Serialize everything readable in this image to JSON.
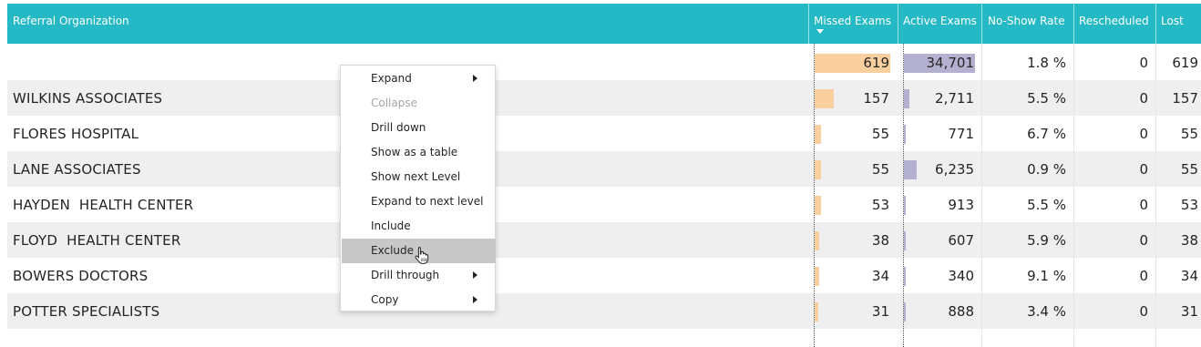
{
  "header": {
    "columns": [
      "Referral Organization",
      "Missed Exams",
      "Active Exams",
      "No-Show Rate",
      "Rescheduled",
      "Lost"
    ],
    "sorted_column": "Missed Exams",
    "sort_direction": "descending"
  },
  "rows": [
    {
      "name": "",
      "missed": "619",
      "active": "34,701",
      "noshow": "1.8 %",
      "rescheduled": "0",
      "lost": "619",
      "missed_fraction": 1.0,
      "active_fraction": 1.0
    },
    {
      "name": "WILKINS ASSOCIATES",
      "missed": "157",
      "active": "2,711",
      "noshow": "5.5 %",
      "rescheduled": "0",
      "lost": "157",
      "missed_fraction": 0.254,
      "active_fraction": 0.078
    },
    {
      "name": "FLORES HOSPITAL",
      "missed": "55",
      "active": "771",
      "noshow": "6.7 %",
      "rescheduled": "0",
      "lost": "55",
      "missed_fraction": 0.089,
      "active_fraction": 0.022
    },
    {
      "name": "LANE ASSOCIATES",
      "missed": "55",
      "active": "6,235",
      "noshow": "0.9 %",
      "rescheduled": "0",
      "lost": "55",
      "missed_fraction": 0.089,
      "active_fraction": 0.18
    },
    {
      "name": "HAYDEN  HEALTH CENTER",
      "missed": "53",
      "active": "913",
      "noshow": "5.5 %",
      "rescheduled": "0",
      "lost": "53",
      "missed_fraction": 0.086,
      "active_fraction": 0.026
    },
    {
      "name": "FLOYD  HEALTH CENTER",
      "missed": "38",
      "active": "607",
      "noshow": "5.9 %",
      "rescheduled": "0",
      "lost": "38",
      "missed_fraction": 0.061,
      "active_fraction": 0.017
    },
    {
      "name": "BOWERS DOCTORS",
      "missed": "34",
      "active": "340",
      "noshow": "9.1 %",
      "rescheduled": "0",
      "lost": "34",
      "missed_fraction": 0.055,
      "active_fraction": 0.01
    },
    {
      "name": "POTTER SPECIALISTS",
      "missed": "31",
      "active": "888",
      "noshow": "3.4 %",
      "rescheduled": "0",
      "lost": "31",
      "missed_fraction": 0.05,
      "active_fraction": 0.026
    }
  ],
  "context_menu": {
    "items": [
      {
        "label": "Expand",
        "submenu": true,
        "disabled": false,
        "hovered": false
      },
      {
        "label": "Collapse",
        "submenu": false,
        "disabled": true,
        "hovered": false
      },
      {
        "label": "Drill down",
        "submenu": false,
        "disabled": false,
        "hovered": false
      },
      {
        "label": "Show as a table",
        "submenu": false,
        "disabled": false,
        "hovered": false
      },
      {
        "label": "Show next Level",
        "submenu": false,
        "disabled": false,
        "hovered": false
      },
      {
        "label": "Expand to next level",
        "submenu": false,
        "disabled": false,
        "hovered": false
      },
      {
        "label": "Include",
        "submenu": false,
        "disabled": false,
        "hovered": false
      },
      {
        "label": "Exclude",
        "submenu": false,
        "disabled": false,
        "hovered": true
      },
      {
        "label": "Drill through",
        "submenu": true,
        "disabled": false,
        "hovered": false
      },
      {
        "label": "Copy",
        "submenu": true,
        "disabled": false,
        "hovered": false
      }
    ]
  },
  "colors": {
    "header_bg": "#25b8c5",
    "missed_bar": "#f9cf9f",
    "active_bar": "#b3b1cf",
    "row_alt_bg": "#efefef",
    "menu_hover": "#c8c8c8"
  },
  "icons": {
    "sort": "sort-descending-icon",
    "submenu": "chevron-right-icon",
    "cursor": "hand-pointer-icon"
  }
}
